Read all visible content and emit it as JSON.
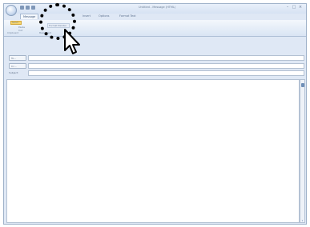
{
  "window": {
    "title": "Untitled - Message (HTML)"
  },
  "ribbon": {
    "tabs": [
      {
        "label": "Message"
      },
      {
        "label": "Insert"
      },
      {
        "label": "Options"
      },
      {
        "label": "Format Text"
      }
    ],
    "items": {
      "send": "Send",
      "paste": "Paste",
      "cut": "Cut",
      "copy": "Copy",
      "highlighted": "Format Painter"
    },
    "groups": {
      "clipboard": "Clipboard",
      "basic_text": "Basic Text"
    }
  },
  "fields": {
    "to_label": "To...",
    "cc_label": "Cc...",
    "subject_label": "Subject:"
  },
  "colors": {
    "ribbon": "#dfe8f5",
    "highlight_ring": "#000000",
    "send_button": "#f7d56c"
  }
}
